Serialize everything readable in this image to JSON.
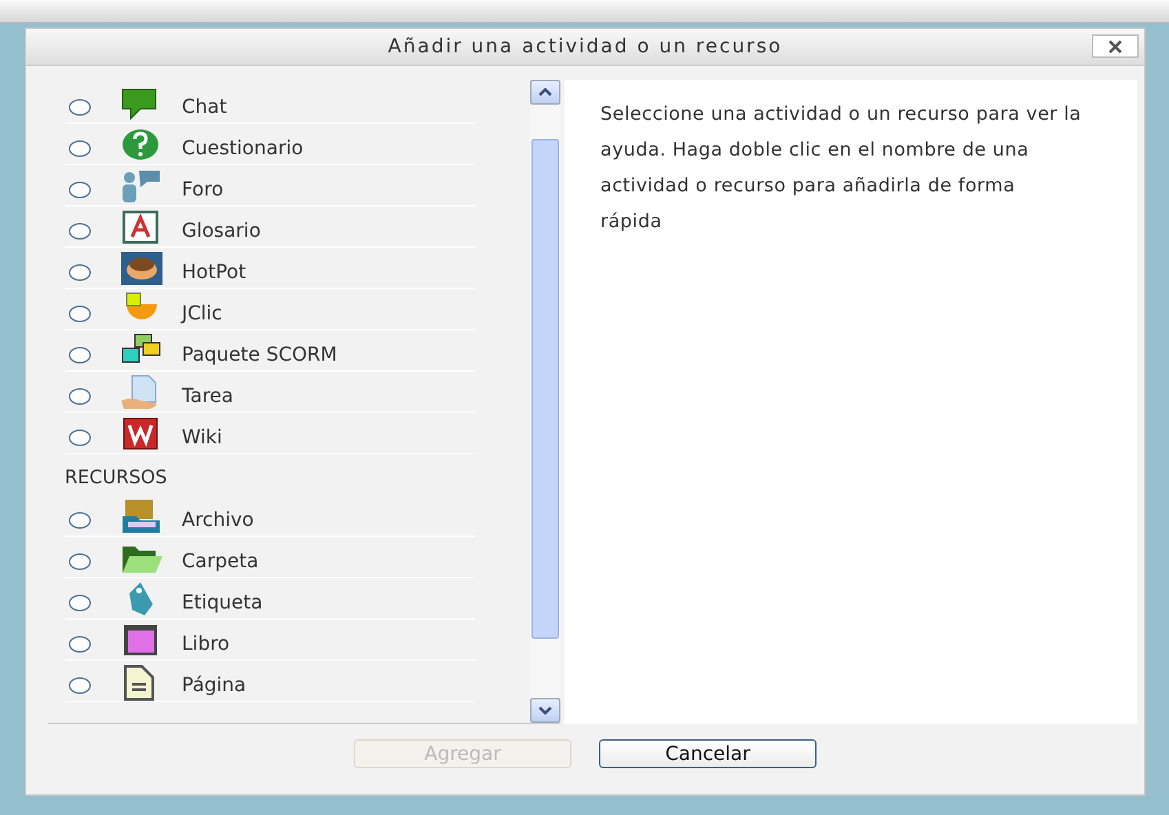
{
  "dialog": {
    "title": "Añadir una actividad o un recurso"
  },
  "activities": [
    {
      "label": "Chat",
      "selected": false
    },
    {
      "label": "Cuestionario",
      "selected": false
    },
    {
      "label": "Foro",
      "selected": false
    },
    {
      "label": "Glosario",
      "selected": false
    },
    {
      "label": "HotPot",
      "selected": false
    },
    {
      "label": "JClic",
      "selected": false
    },
    {
      "label": "Paquete SCORM",
      "selected": false
    },
    {
      "label": "Tarea",
      "selected": false
    },
    {
      "label": "Wiki",
      "selected": false
    }
  ],
  "resources_heading": "RECURSOS",
  "resources": [
    {
      "label": "Archivo",
      "selected": false
    },
    {
      "label": "Carpeta",
      "selected": false
    },
    {
      "label": "Etiqueta",
      "selected": false
    },
    {
      "label": "Libro",
      "selected": false
    },
    {
      "label": "Página",
      "selected": false
    }
  ],
  "help_text": "Seleccione una actividad o un recurso para ver la ayuda. Haga doble clic en el nombre de una actividad o recurso para añadirla de forma rápida",
  "buttons": [
    {
      "label": "Agregar",
      "disabled": true
    },
    {
      "label": "Cancelar",
      "disabled": false
    }
  ]
}
